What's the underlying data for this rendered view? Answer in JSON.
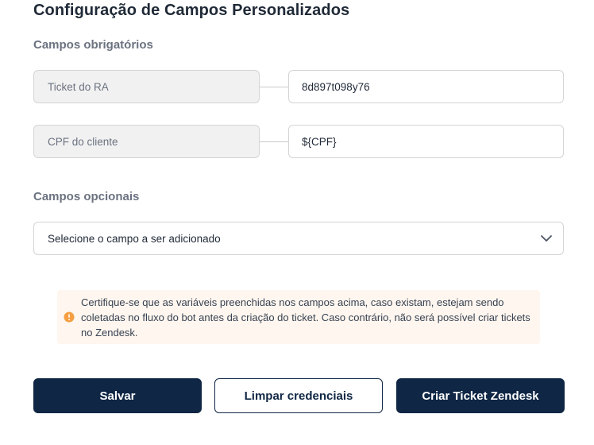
{
  "title": "Configuração de Campos Personalizados",
  "required_section": {
    "label": "Campos obrigatórios",
    "fields": [
      {
        "label": "Ticket do RA",
        "value": "8d897t098y76"
      },
      {
        "label": "CPF do cliente",
        "value": "${CPF}"
      }
    ]
  },
  "optional_section": {
    "label": "Campos opcionais",
    "select_value": "Selecione o campo a ser adicionado"
  },
  "alert": {
    "text": "Certifique-se que as variáveis preenchidas nos campos acima, caso existam, estejam sendo coletadas no fluxo do bot antes da criação do ticket. Caso contrário, não será possível criar tickets no Zendesk.",
    "color": "#f59e42"
  },
  "buttons": {
    "save": "Salvar",
    "clear": "Limpar credenciais",
    "create": "Criar Ticket Zendesk"
  },
  "colors": {
    "primary": "#0f2644"
  }
}
